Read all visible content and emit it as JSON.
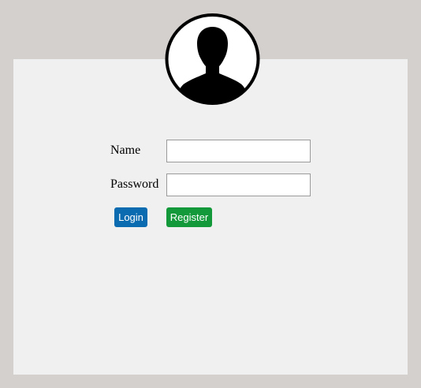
{
  "form": {
    "name_label": "Name",
    "password_label": "Password",
    "name_value": "",
    "password_value": "",
    "login_label": "Login",
    "register_label": "Register"
  },
  "icons": {
    "avatar": "user-silhouette-icon"
  },
  "colors": {
    "page_background": "#d4d0ce",
    "panel_background": "#f0f0f0",
    "login_button": "#0a6bb0",
    "register_button": "#13993a"
  }
}
